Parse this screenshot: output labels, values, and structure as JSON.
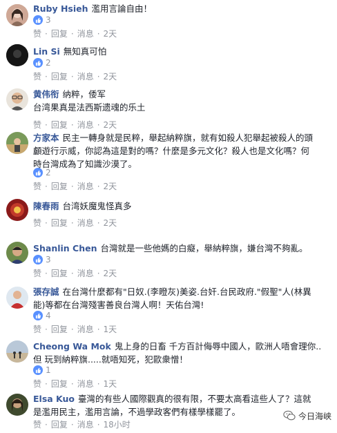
{
  "comments": [
    {
      "author": "Ruby Hsieh",
      "text": "濫用言論自由！",
      "likes": "3",
      "actions": {
        "like": "赞",
        "reply": "回复",
        "message": "消息",
        "time": "2天"
      }
    },
    {
      "author": "Lin Si",
      "text": "無知真可怕",
      "likes": "2",
      "actions": {
        "like": "赞",
        "reply": "回复",
        "message": "消息",
        "time": "2天"
      }
    },
    {
      "author": "黄伟衔",
      "text": "纳粹，倭军",
      "text2": "台湾果真是法西斯遗魂的乐土",
      "likes": "",
      "actions": {
        "like": "赞",
        "reply": "回复",
        "message": "消息",
        "time": "2天"
      }
    },
    {
      "author": "方家本",
      "text": "民主一轉身就是民粹，舉起納粹旗，就有如殺人犯舉起被殺人的頭",
      "text2": "顱遊行示威，你認為這是對的嗎？什麼是多元文化？殺人也是文化嗎？何",
      "text3": "時台灣成為了知識沙漠了。",
      "likes": "2",
      "actions": {
        "like": "赞",
        "reply": "回复",
        "message": "消息",
        "time": "2天"
      }
    },
    {
      "author": "陳春雨",
      "text": "台湾妖魔鬼怪真多",
      "likes": "",
      "actions": {
        "like": "赞",
        "reply": "回复",
        "message": "消息",
        "time": "2天"
      }
    },
    {
      "author": "Shanlin Chen",
      "text": "台灣就是一些他媽的白癡，舉納粹旗，嫌台灣不夠亂。",
      "likes": "3",
      "actions": {
        "like": "赞",
        "reply": "回复",
        "message": "消息",
        "time": "2天"
      }
    },
    {
      "author": "張存誠",
      "text": "在台灣什麼都有\"日奴.(李瞪灰)美姿.台奸.台民政府.\"假聖\"人(林異",
      "text2": "能)等都在台灣殘害善良台灣人啊！天佑台灣!",
      "likes": "4",
      "actions": {
        "like": "赞",
        "reply": "回复",
        "message": "消息",
        "time": "1天"
      }
    },
    {
      "author": "Cheong Wa Mok",
      "text": "鬼上身的日畜 千方百計侮辱中國人，歐洲人唔會理你..",
      "text2": "但 玩到納粹旗.....就唔知死，犯歐衆憎！",
      "likes": "1",
      "actions": {
        "like": "赞",
        "reply": "回复",
        "message": "消息",
        "time": "1天"
      }
    },
    {
      "author": "Elsa Kuo",
      "text": "臺灣的有些人國際觀真的很有限，不要太高看這些人了？這就",
      "text2": "是濫用民主，濫用言論，不過學政客們有樣學樣罷了。",
      "likes": "",
      "actions": {
        "like": "赞",
        "reply": "回复",
        "message": "消息",
        "time": "18小时"
      }
    }
  ],
  "watermark": "今日海峡",
  "colors": {
    "author": "#385898",
    "meta": "#90949c",
    "like": "#5890ff"
  }
}
